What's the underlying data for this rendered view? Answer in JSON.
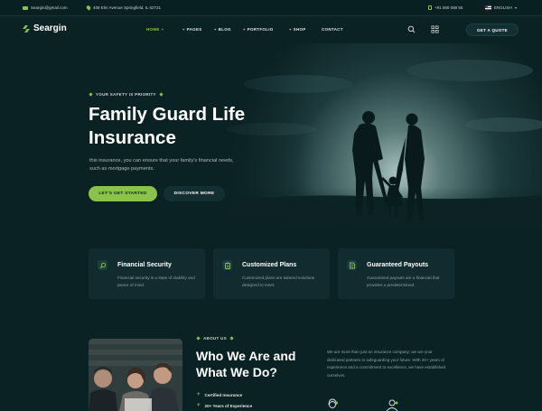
{
  "topbar": {
    "email": "Seargin@gmail.com",
    "address": "408 Elm Avenue Springfield, IL 62721",
    "phone": "+91 590 088 55",
    "language": "ENGLISH"
  },
  "brand": {
    "name": "Seargin"
  },
  "nav": {
    "items": [
      {
        "label": "HOME"
      },
      {
        "label": "PAGES"
      },
      {
        "label": "BLOG"
      },
      {
        "label": "PORTFOLIO"
      },
      {
        "label": "SHOP"
      },
      {
        "label": "CONTACT"
      }
    ],
    "cta": "GET A QUOTE"
  },
  "hero": {
    "tag": "YOUR SAFETY IS PRIORITY",
    "title_line1": "Family Guard Life",
    "title_line2": "Insurance",
    "subtitle": "this insurance, you can ensure that your family's financial needs, such as mortgage payments.",
    "primary_button": "LET'S GET STARTED",
    "secondary_button": "DISCOVER MORE"
  },
  "features": [
    {
      "title": "Financial Security",
      "desc": "Financial security is a state of stability and peace of mind.",
      "icon": "search-shield-icon"
    },
    {
      "title": "Customized Plans",
      "desc": "Customized plans are tailored solutions designed to meet.",
      "icon": "clipboard-icon"
    },
    {
      "title": "Guaranteed Payouts",
      "desc": "Guaranteed payouts are a financial that provides a predetermined.",
      "icon": "document-check-icon"
    }
  ],
  "about": {
    "tag": "ABOUT US",
    "title_line1": "Who We Are and",
    "title_line2": "What We Do?",
    "list": [
      "Certified Insurance",
      "20+ Years of Experience"
    ],
    "text": "We are more than just an insurance company; we are your dedicated partners in safeguarding your future. With 20+ years of experience and a commitment to excellence, we have established ourselves."
  },
  "colors": {
    "accent": "#8bc34a",
    "background": "#0b2224",
    "card": "#112b2e"
  }
}
